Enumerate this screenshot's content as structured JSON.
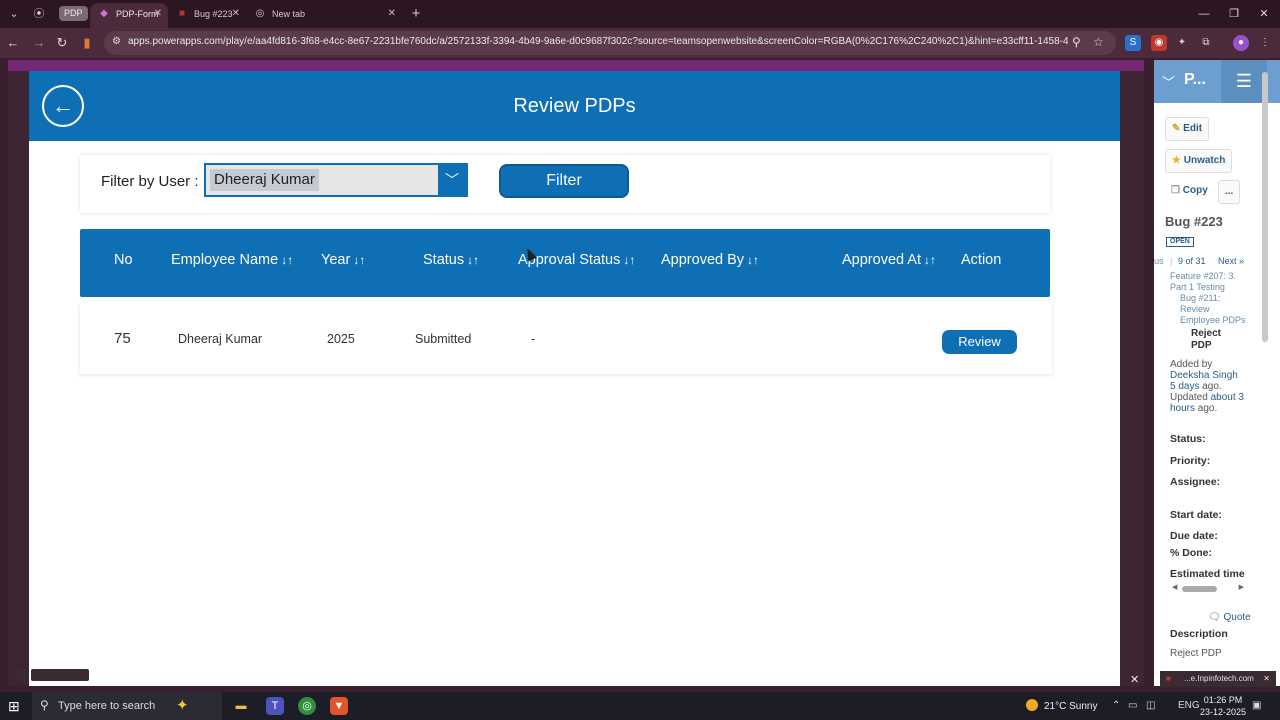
{
  "browser": {
    "pill_label": "PDP",
    "tabs": [
      {
        "title": "PDP-Form",
        "active": true
      },
      {
        "title": "Bug #223",
        "active": false
      },
      {
        "title": "New tab",
        "active": false
      }
    ],
    "url": "apps.powerapps.com/play/e/aa4fd816-3f68-e4cc-8e67-2231bfe760dc/a/2572133f-3394-4b49-9a6e-d0c9687f302c?source=teamsopenwebsite&screenColor=RGBA(0%2C176%2C240%2C1)&hint=e33cff11-1458-4f2d-9a92-a3b..."
  },
  "app": {
    "title": "Review PDPs",
    "filter": {
      "label": "Filter by User :",
      "selected_user": "Dheeraj Kumar",
      "button_label": "Filter"
    },
    "table": {
      "columns": [
        "No",
        "Employee Name",
        "Year",
        "Status",
        "Approval Status",
        "Approved By",
        "Approved At",
        "Action"
      ],
      "rows": [
        {
          "no": "75",
          "employee_name": "Dheeraj Kumar",
          "year": "2025",
          "status": "Submitted",
          "approval_status": "-",
          "approved_by": "",
          "approved_at": "",
          "action": "Review"
        }
      ]
    }
  },
  "side_panel": {
    "header_title": "P...",
    "buttons": {
      "edit": "Edit",
      "unwatch": "Unwatch",
      "copy": "Copy",
      "more": "..."
    },
    "issue_title": "Bug #223",
    "state_badge": "OPEN",
    "nav": {
      "prev": "us",
      "position": "9 of 31",
      "next": "Next »"
    },
    "parent_links": {
      "feature": "Feature #207: 3. Part 1 Testing",
      "bug": "Bug #211: Review Employee PDPs"
    },
    "subject": "Reject PDP",
    "added_by_prefix": "Added by",
    "added_by_name": "Deeksha Singh",
    "added_ago": "5 days",
    "added_suffix": "ago.",
    "updated_prefix": "Updated",
    "updated_ago": "about 3 hours",
    "updated_suffix": "ago.",
    "fields": [
      "Status:",
      "Priority:",
      "Assignee:",
      "Start date:",
      "Due date:",
      "% Done:",
      "Estimated time"
    ],
    "quote_label": "Quote",
    "description_label": "Description",
    "description_text": "Reject PDP"
  },
  "notification": {
    "text": "...e.Inpinfotech.com"
  },
  "taskbar": {
    "search_placeholder": "Type here to search",
    "weather": "21°C  Sunny",
    "language": "ENG",
    "time": "01:26 PM",
    "date": "23-12-2025"
  }
}
